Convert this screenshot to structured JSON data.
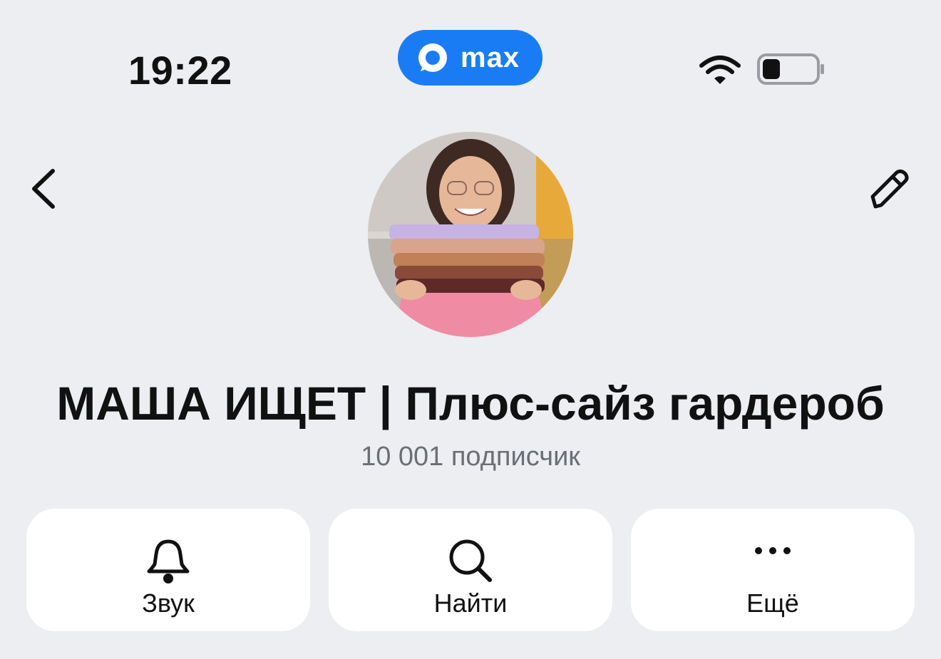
{
  "status_bar": {
    "time": "19:22",
    "app_badge": "max"
  },
  "header": {
    "back_icon": "chevron-left-icon",
    "edit_icon": "pencil-icon"
  },
  "profile": {
    "title": "МАША ИЩЕТ | Плюс-сайз гардероб",
    "subscribers": "10 001 подписчик"
  },
  "actions": [
    {
      "label": "Звук",
      "icon": "bell-icon"
    },
    {
      "label": "Найти",
      "icon": "search-icon"
    },
    {
      "label": "Ещё",
      "icon": "more-icon"
    }
  ],
  "colors": {
    "background": "#ECEEF2",
    "accent": "#1A7CF5",
    "card": "#FFFFFF",
    "secondary_text": "#6B6E75"
  }
}
